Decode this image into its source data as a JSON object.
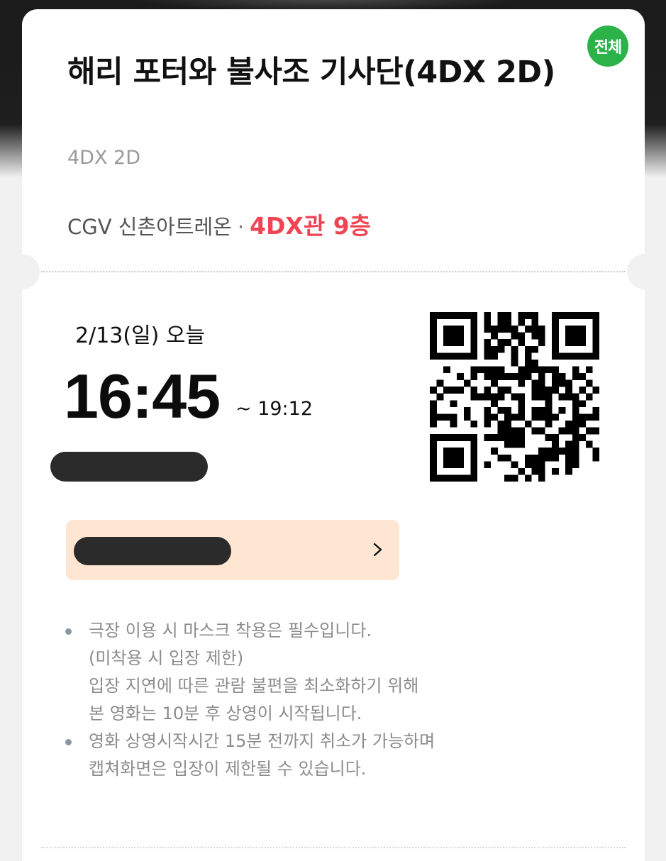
{
  "ticket": {
    "rating_badge": "전체",
    "movie_title": "해리 포터와 불사조 기사단(4DX 2D)",
    "format": "4DX 2D",
    "theater": "CGV 신촌아트레온",
    "separator": "·",
    "screen": "4DX관 9층",
    "date": "2/13(일) 오늘",
    "start_time": "16:45",
    "end_time": "~ 19:12",
    "qr_code_icon": "qr-code-icon",
    "notes": [
      {
        "lines": [
          "극장 이용 시 마스크 착용은 필수입니다.",
          "(미착용 시 입장 제한)",
          "입장 지연에 따른 관람 불편을 최소화하기 위해",
          "본 영화는 10분 후 상영이 시작됩니다."
        ]
      },
      {
        "lines": [
          "영화 상영시작시간 15분 전까지 취소가 가능하며",
          "캡쳐화면은 입장이 제한될 수 있습니다."
        ]
      }
    ]
  },
  "colors": {
    "rating_green": "#2bb34a",
    "screen_red": "#ef4454",
    "panel_peach": "#ffe6d2",
    "redaction": "#2b2b2b"
  }
}
